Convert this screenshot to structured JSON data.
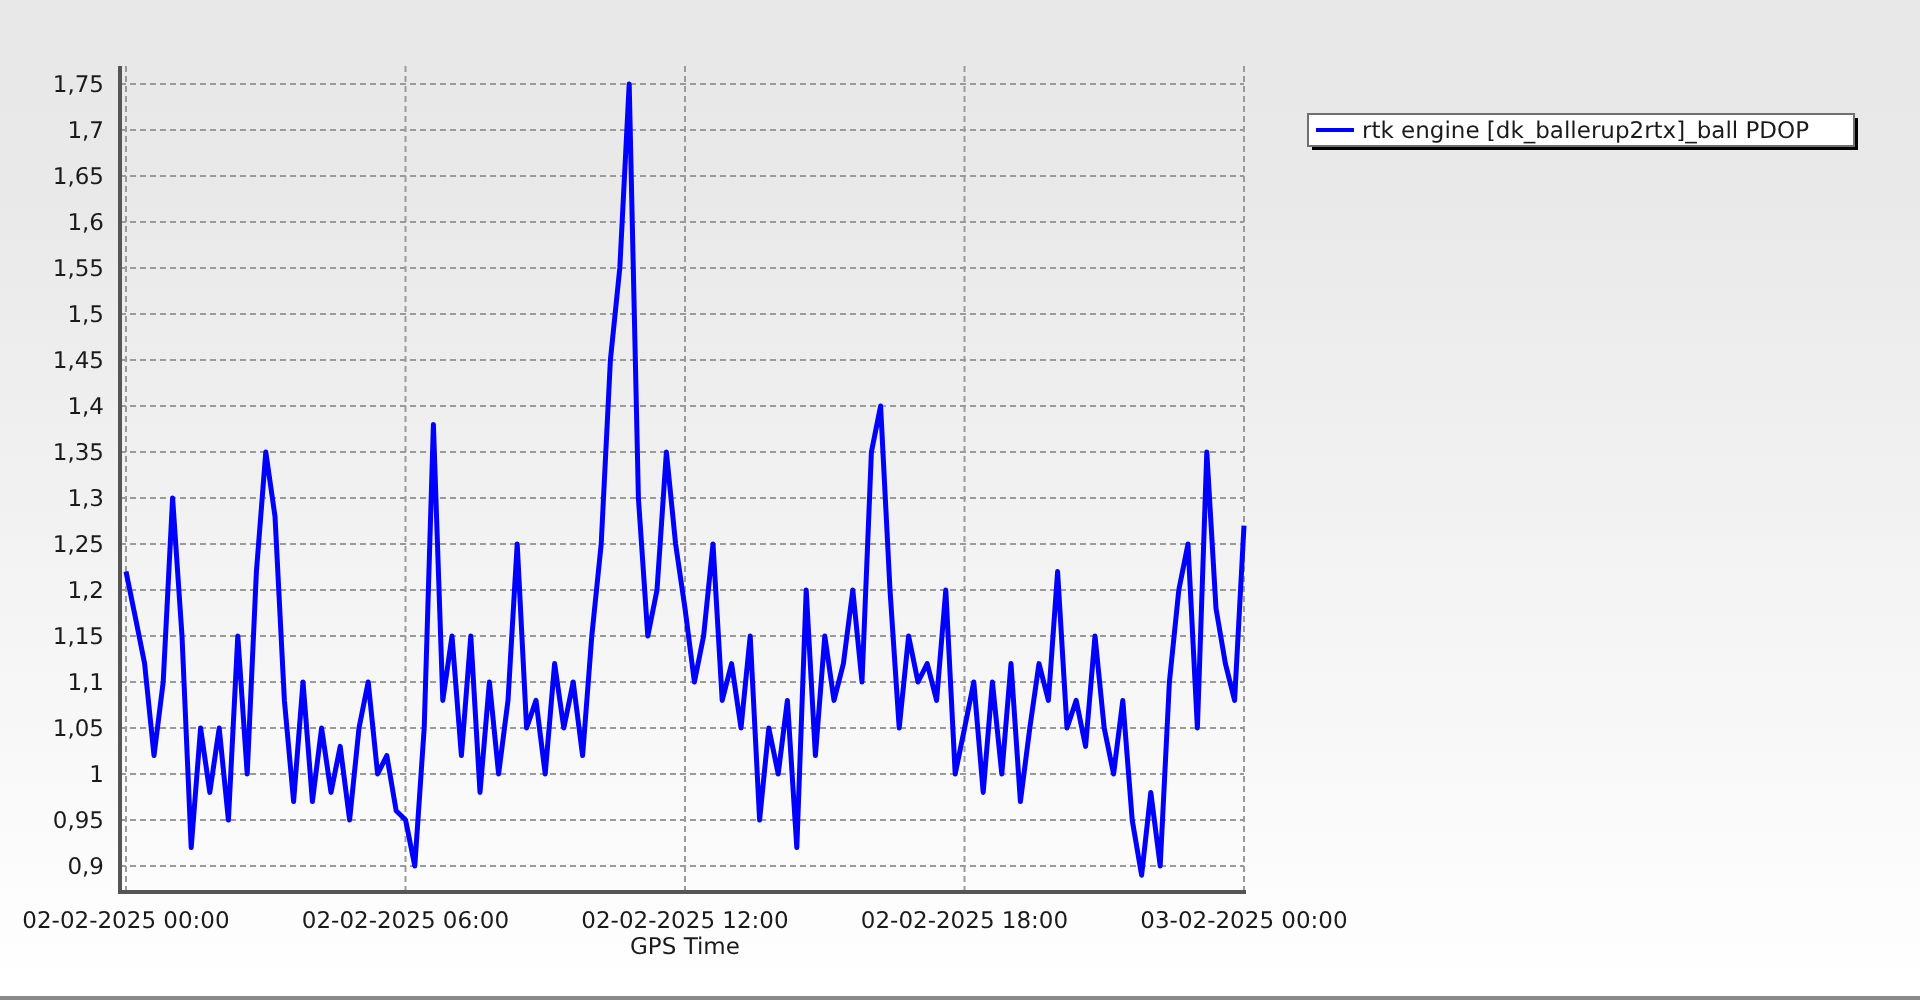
{
  "chart_data": {
    "type": "line",
    "xlabel": "GPS Time",
    "categories": [
      "02-02-2025 00:00",
      null,
      null,
      null,
      null,
      null,
      null,
      null,
      null,
      null,
      null,
      null,
      null,
      null,
      null,
      null,
      null,
      null,
      null,
      null,
      null,
      null,
      null,
      null,
      null,
      null,
      null,
      null,
      null,
      null,
      "02-02-2025 06:00",
      null,
      null,
      null,
      null,
      null,
      null,
      null,
      null,
      null,
      null,
      null,
      null,
      null,
      null,
      null,
      null,
      null,
      null,
      null,
      null,
      null,
      null,
      null,
      null,
      null,
      null,
      null,
      null,
      null,
      "02-02-2025 12:00",
      null,
      null,
      null,
      null,
      null,
      null,
      null,
      null,
      null,
      null,
      null,
      null,
      null,
      null,
      null,
      null,
      null,
      null,
      null,
      null,
      null,
      null,
      null,
      null,
      null,
      null,
      null,
      null,
      null,
      "02-02-2025 18:00",
      null,
      null,
      null,
      null,
      null,
      null,
      null,
      null,
      null,
      null,
      null,
      null,
      null,
      null,
      null,
      null,
      null,
      null,
      null,
      null,
      null,
      null,
      null,
      null,
      null,
      null,
      null,
      null,
      null,
      "03-02-2025 00:00"
    ],
    "series": [
      {
        "name": "rtk engine [dk_ballerup2rtx]_ball PDOP",
        "color": "#0000ff",
        "values": [
          1.22,
          1.17,
          1.12,
          1.02,
          1.1,
          1.3,
          1.15,
          0.92,
          1.05,
          0.98,
          1.05,
          0.95,
          1.15,
          1.0,
          1.22,
          1.35,
          1.28,
          1.08,
          0.97,
          1.1,
          0.97,
          1.05,
          0.98,
          1.03,
          0.95,
          1.05,
          1.1,
          1.0,
          1.02,
          0.96,
          0.95,
          0.9,
          1.05,
          1.38,
          1.08,
          1.15,
          1.02,
          1.15,
          0.98,
          1.1,
          1.0,
          1.08,
          1.25,
          1.05,
          1.08,
          1.0,
          1.12,
          1.05,
          1.1,
          1.02,
          1.15,
          1.25,
          1.45,
          1.55,
          1.75,
          1.3,
          1.15,
          1.2,
          1.35,
          1.25,
          1.18,
          1.1,
          1.15,
          1.25,
          1.08,
          1.12,
          1.05,
          1.15,
          0.95,
          1.05,
          1.0,
          1.08,
          0.92,
          1.2,
          1.02,
          1.15,
          1.08,
          1.12,
          1.2,
          1.1,
          1.35,
          1.4,
          1.2,
          1.05,
          1.15,
          1.1,
          1.12,
          1.08,
          1.2,
          1.0,
          1.05,
          1.1,
          0.98,
          1.1,
          1.0,
          1.12,
          0.97,
          1.05,
          1.12,
          1.08,
          1.22,
          1.05,
          1.08,
          1.03,
          1.15,
          1.05,
          1.0,
          1.08,
          0.95,
          0.89,
          0.98,
          0.9,
          1.1,
          1.2,
          1.25,
          1.05,
          1.35,
          1.18,
          1.12,
          1.08,
          1.27
        ]
      }
    ],
    "grid": true,
    "ylim": [
      0.875,
      1.775
    ],
    "yticks": [
      {
        "value": 0.9,
        "label": "0,9"
      },
      {
        "value": 0.95,
        "label": "0,95"
      },
      {
        "value": 1,
        "label": "1"
      },
      {
        "value": 1.05,
        "label": "1,05"
      },
      {
        "value": 1.1,
        "label": "1,1"
      },
      {
        "value": 1.15,
        "label": "1,15"
      },
      {
        "value": 1.2,
        "label": "1,2"
      },
      {
        "value": 1.25,
        "label": "1,25"
      },
      {
        "value": 1.3,
        "label": "1,3"
      },
      {
        "value": 1.35,
        "label": "1,35"
      },
      {
        "value": 1.4,
        "label": "1,4"
      },
      {
        "value": 1.45,
        "label": "1,45"
      },
      {
        "value": 1.5,
        "label": "1,5"
      },
      {
        "value": 1.55,
        "label": "1,55"
      },
      {
        "value": 1.6,
        "label": "1,6"
      },
      {
        "value": 1.65,
        "label": "1,65"
      },
      {
        "value": 1.7,
        "label": "1,7"
      },
      {
        "value": 1.75,
        "label": "1,75"
      }
    ]
  }
}
